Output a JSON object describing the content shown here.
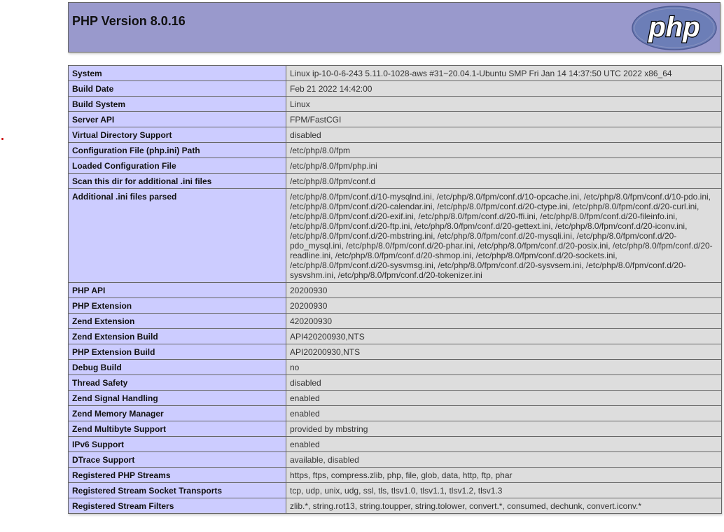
{
  "header": {
    "title": "PHP Version 8.0.16",
    "logo_text": "php"
  },
  "colors": {
    "header_bg": "#9999cc",
    "key_cell_bg": "#ccccff",
    "value_cell_bg": "#dddddd",
    "border": "#666666",
    "logo_fill": "#6c7eb7"
  },
  "rows": [
    {
      "key": "System",
      "value": "Linux ip-10-0-6-243 5.11.0-1028-aws #31~20.04.1-Ubuntu SMP Fri Jan 14 14:37:50 UTC 2022 x86_64"
    },
    {
      "key": "Build Date",
      "value": "Feb 21 2022 14:42:00"
    },
    {
      "key": "Build System",
      "value": "Linux"
    },
    {
      "key": "Server API",
      "value": "FPM/FastCGI"
    },
    {
      "key": "Virtual Directory Support",
      "value": "disabled"
    },
    {
      "key": "Configuration File (php.ini) Path",
      "value": "/etc/php/8.0/fpm"
    },
    {
      "key": "Loaded Configuration File",
      "value": "/etc/php/8.0/fpm/php.ini"
    },
    {
      "key": "Scan this dir for additional .ini files",
      "value": "/etc/php/8.0/fpm/conf.d"
    },
    {
      "key": "Additional .ini files parsed",
      "value": "/etc/php/8.0/fpm/conf.d/10-mysqlnd.ini, /etc/php/8.0/fpm/conf.d/10-opcache.ini, /etc/php/8.0/fpm/conf.d/10-pdo.ini, /etc/php/8.0/fpm/conf.d/20-calendar.ini, /etc/php/8.0/fpm/conf.d/20-ctype.ini, /etc/php/8.0/fpm/conf.d/20-curl.ini, /etc/php/8.0/fpm/conf.d/20-exif.ini, /etc/php/8.0/fpm/conf.d/20-ffi.ini, /etc/php/8.0/fpm/conf.d/20-fileinfo.ini, /etc/php/8.0/fpm/conf.d/20-ftp.ini, /etc/php/8.0/fpm/conf.d/20-gettext.ini, /etc/php/8.0/fpm/conf.d/20-iconv.ini, /etc/php/8.0/fpm/conf.d/20-mbstring.ini, /etc/php/8.0/fpm/conf.d/20-mysqli.ini, /etc/php/8.0/fpm/conf.d/20-pdo_mysql.ini, /etc/php/8.0/fpm/conf.d/20-phar.ini, /etc/php/8.0/fpm/conf.d/20-posix.ini, /etc/php/8.0/fpm/conf.d/20-readline.ini, /etc/php/8.0/fpm/conf.d/20-shmop.ini, /etc/php/8.0/fpm/conf.d/20-sockets.ini, /etc/php/8.0/fpm/conf.d/20-sysvmsg.ini, /etc/php/8.0/fpm/conf.d/20-sysvsem.ini, /etc/php/8.0/fpm/conf.d/20-sysvshm.ini, /etc/php/8.0/fpm/conf.d/20-tokenizer.ini"
    },
    {
      "key": "PHP API",
      "value": "20200930"
    },
    {
      "key": "PHP Extension",
      "value": "20200930"
    },
    {
      "key": "Zend Extension",
      "value": "420200930"
    },
    {
      "key": "Zend Extension Build",
      "value": "API420200930,NTS"
    },
    {
      "key": "PHP Extension Build",
      "value": "API20200930,NTS"
    },
    {
      "key": "Debug Build",
      "value": "no"
    },
    {
      "key": "Thread Safety",
      "value": "disabled"
    },
    {
      "key": "Zend Signal Handling",
      "value": "enabled"
    },
    {
      "key": "Zend Memory Manager",
      "value": "enabled"
    },
    {
      "key": "Zend Multibyte Support",
      "value": "provided by mbstring"
    },
    {
      "key": "IPv6 Support",
      "value": "enabled"
    },
    {
      "key": "DTrace Support",
      "value": "available, disabled"
    },
    {
      "key": "Registered PHP Streams",
      "value": "https, ftps, compress.zlib, php, file, glob, data, http, ftp, phar"
    },
    {
      "key": "Registered Stream Socket Transports",
      "value": "tcp, udp, unix, udg, ssl, tls, tlsv1.0, tlsv1.1, tlsv1.2, tlsv1.3"
    },
    {
      "key": "Registered Stream Filters",
      "value": "zlib.*, string.rot13, string.toupper, string.tolower, convert.*, consumed, dechunk, convert.iconv.*"
    }
  ]
}
